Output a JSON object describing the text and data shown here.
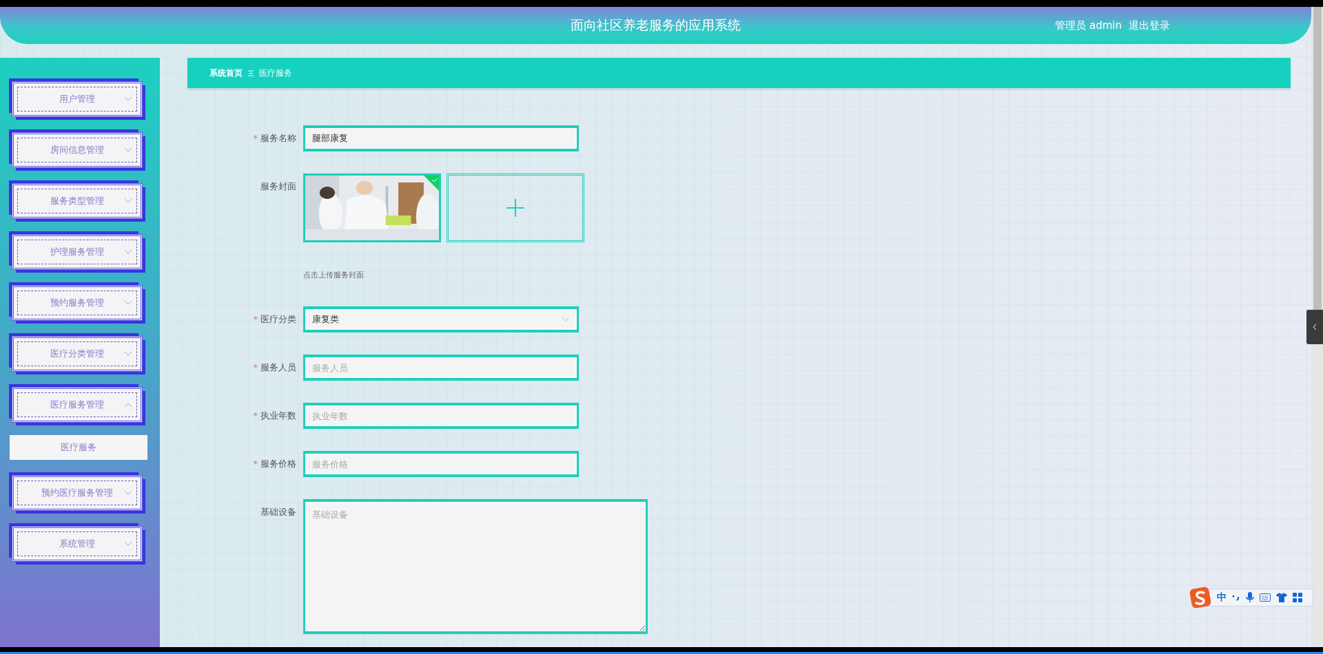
{
  "header": {
    "title": "面向社区养老服务的应用系统",
    "user": "管理员 admin",
    "logout": "退出登录"
  },
  "sidebar": {
    "items": [
      {
        "label": "用户管理",
        "expanded": false
      },
      {
        "label": "房间信息管理",
        "expanded": false
      },
      {
        "label": "服务类型管理",
        "expanded": false
      },
      {
        "label": "护理服务管理",
        "expanded": false
      },
      {
        "label": "预约服务管理",
        "expanded": false
      },
      {
        "label": "医疗分类管理",
        "expanded": false
      },
      {
        "label": "医疗服务管理",
        "expanded": true,
        "children": [
          {
            "label": "医疗服务",
            "selected": true
          }
        ]
      },
      {
        "label": "预约医疗服务管理",
        "expanded": false
      },
      {
        "label": "系统管理",
        "expanded": false
      }
    ]
  },
  "breadcrumb": {
    "items": [
      "系统首页",
      "医疗服务"
    ]
  },
  "form": {
    "fields": [
      {
        "kind": "text",
        "label": "服务名称",
        "required_mark": "*",
        "value": "腿部康复"
      },
      {
        "kind": "upload",
        "label": "服务封面",
        "images": [
          {
            "kind": "picture",
            "success": true
          }
        ],
        "hint": "点击上传服务封面"
      },
      {
        "kind": "select",
        "label": "医疗分类",
        "required_mark": "*",
        "value": "康复类"
      },
      {
        "kind": "text",
        "label": "服务人员",
        "required_mark": "*",
        "placeholder": "服务人员"
      },
      {
        "kind": "text",
        "label": "执业年数",
        "required_mark": "*",
        "placeholder": "执业年数"
      },
      {
        "kind": "text",
        "label": "服务价格",
        "required_mark": "*",
        "placeholder": "服务价格"
      },
      {
        "kind": "textarea",
        "label": "基础设备",
        "placeholder": "基础设备"
      }
    ]
  },
  "ime": {
    "mode": "中"
  }
}
